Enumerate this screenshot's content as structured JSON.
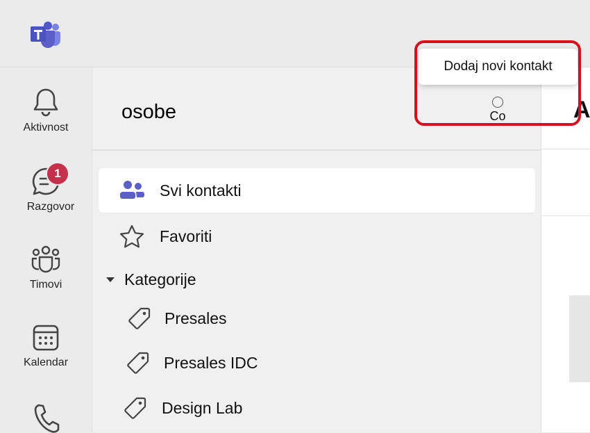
{
  "rail": {
    "items": [
      {
        "label": "Aktivnost",
        "icon": "bell-icon"
      },
      {
        "label": "Razgovor",
        "icon": "chat-icon",
        "badge": "1"
      },
      {
        "label": "Timovi",
        "icon": "teams-icon"
      },
      {
        "label": "Kalendar",
        "icon": "calendar-icon"
      },
      {
        "label": "",
        "icon": "phone-icon"
      }
    ]
  },
  "panel": {
    "title": "osobe",
    "add_contact_short": "Co",
    "tooltip": "Dodaj novi kontakt",
    "nav": [
      {
        "label": "Svi kontakti",
        "icon": "people-icon",
        "selected": true
      },
      {
        "label": "Favoriti",
        "icon": "star-icon",
        "selected": false
      }
    ],
    "categories_label": "Kategorije",
    "categories": [
      {
        "label": "Presales",
        "icon": "tag-icon"
      },
      {
        "label": "Presales IDC",
        "icon": "tag-icon"
      },
      {
        "label": "Design Lab",
        "icon": "tag-icon"
      }
    ]
  },
  "right_pane": {
    "heading_partial": "A"
  },
  "colors": {
    "accent": "#5b5fc7",
    "badge": "#c4314b",
    "highlight": "#d6111e"
  }
}
